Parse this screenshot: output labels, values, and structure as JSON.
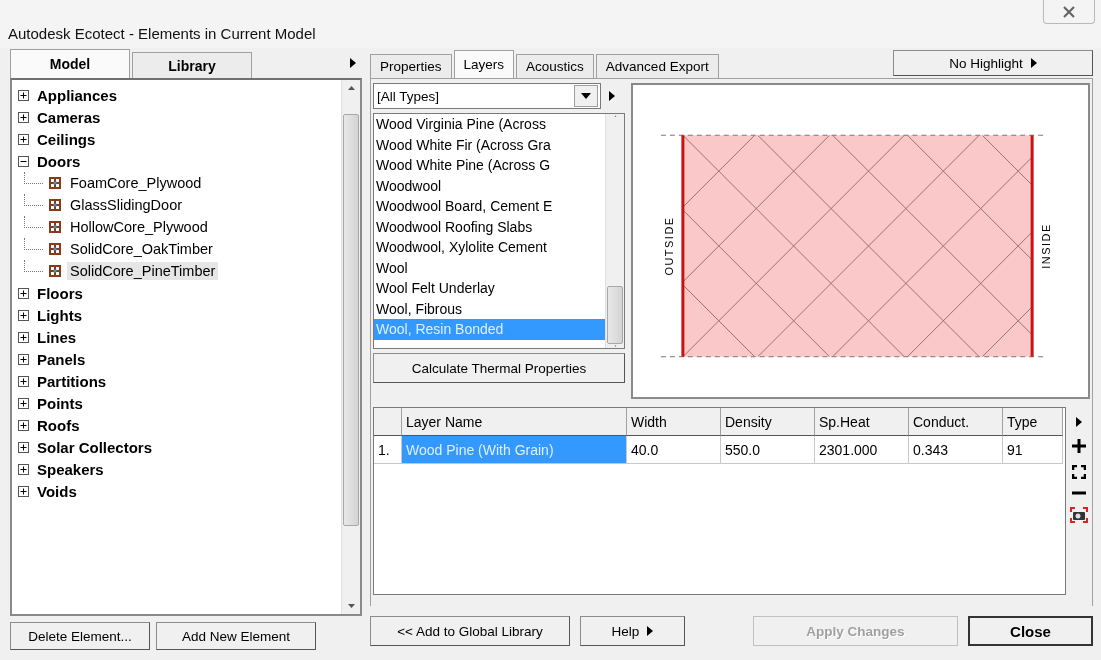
{
  "window": {
    "title": "Autodesk Ecotect - Elements in Current Model"
  },
  "left_tabs": [
    {
      "label": "Model",
      "selected": true
    },
    {
      "label": "Library",
      "selected": false
    }
  ],
  "tree": [
    {
      "label": "Appliances",
      "expanded": false
    },
    {
      "label": "Cameras",
      "expanded": false
    },
    {
      "label": "Ceilings",
      "expanded": false
    },
    {
      "label": "Doors",
      "expanded": true,
      "children": [
        {
          "label": "FoamCore_Plywood",
          "selected": false
        },
        {
          "label": "GlassSlidingDoor",
          "selected": false
        },
        {
          "label": "HollowCore_Plywood",
          "selected": false
        },
        {
          "label": "SolidCore_OakTimber",
          "selected": false
        },
        {
          "label": "SolidCore_PineTimber",
          "selected": true
        }
      ]
    },
    {
      "label": "Floors",
      "expanded": false
    },
    {
      "label": "Lights",
      "expanded": false
    },
    {
      "label": "Lines",
      "expanded": false
    },
    {
      "label": "Panels",
      "expanded": false
    },
    {
      "label": "Partitions",
      "expanded": false
    },
    {
      "label": "Points",
      "expanded": false
    },
    {
      "label": "Roofs",
      "expanded": false
    },
    {
      "label": "Solar Collectors",
      "expanded": false
    },
    {
      "label": "Speakers",
      "expanded": false
    },
    {
      "label": "Voids",
      "expanded": false
    }
  ],
  "left_buttons": [
    "Delete Element...",
    "Add New Element"
  ],
  "tabs": [
    {
      "label": "Properties",
      "selected": false
    },
    {
      "label": "Layers",
      "selected": true
    },
    {
      "label": "Acoustics",
      "selected": false
    },
    {
      "label": "Advanced Export",
      "selected": false
    }
  ],
  "highlight_button": "No Highlight",
  "type_filter": {
    "value": "[All Types]"
  },
  "materials": [
    {
      "label": "Wood Virginia Pine (Across",
      "selected": false
    },
    {
      "label": "Wood White Fir (Across Gra",
      "selected": false
    },
    {
      "label": "Wood White Pine (Across G",
      "selected": false
    },
    {
      "label": "Woodwool",
      "selected": false
    },
    {
      "label": "Woodwool Board, Cement E",
      "selected": false
    },
    {
      "label": "Woodwool Roofing Slabs",
      "selected": false
    },
    {
      "label": "Woodwool, Xylolite Cement",
      "selected": false
    },
    {
      "label": "Wool",
      "selected": false
    },
    {
      "label": "Wool Felt Underlay",
      "selected": false
    },
    {
      "label": "Wool, Fibrous",
      "selected": false
    },
    {
      "label": "Wool, Resin Bonded",
      "selected": true
    }
  ],
  "calculate_button": "Calculate Thermal Properties",
  "preview": {
    "outside_label": "OUTSIDE",
    "inside_label": "INSIDE"
  },
  "layers_table": {
    "columns": [
      "Layer Name",
      "Width",
      "Density",
      "Sp.Heat",
      "Conduct.",
      "Type"
    ],
    "rows": [
      {
        "number": "1.",
        "cells": [
          "Wood Pine (With Grain)",
          "40.0",
          "550.0",
          "2301.000",
          "0.343",
          "91"
        ],
        "selected": true
      }
    ]
  },
  "bottom_buttons": [
    {
      "label": "<< Add to Global Library",
      "kind": "plain",
      "disabled": false
    },
    {
      "label": "Help",
      "kind": "menu",
      "disabled": false
    },
    {
      "label": "Apply Changes",
      "kind": "plain",
      "disabled": true
    },
    {
      "label": "Close",
      "kind": "default",
      "disabled": false
    }
  ]
}
